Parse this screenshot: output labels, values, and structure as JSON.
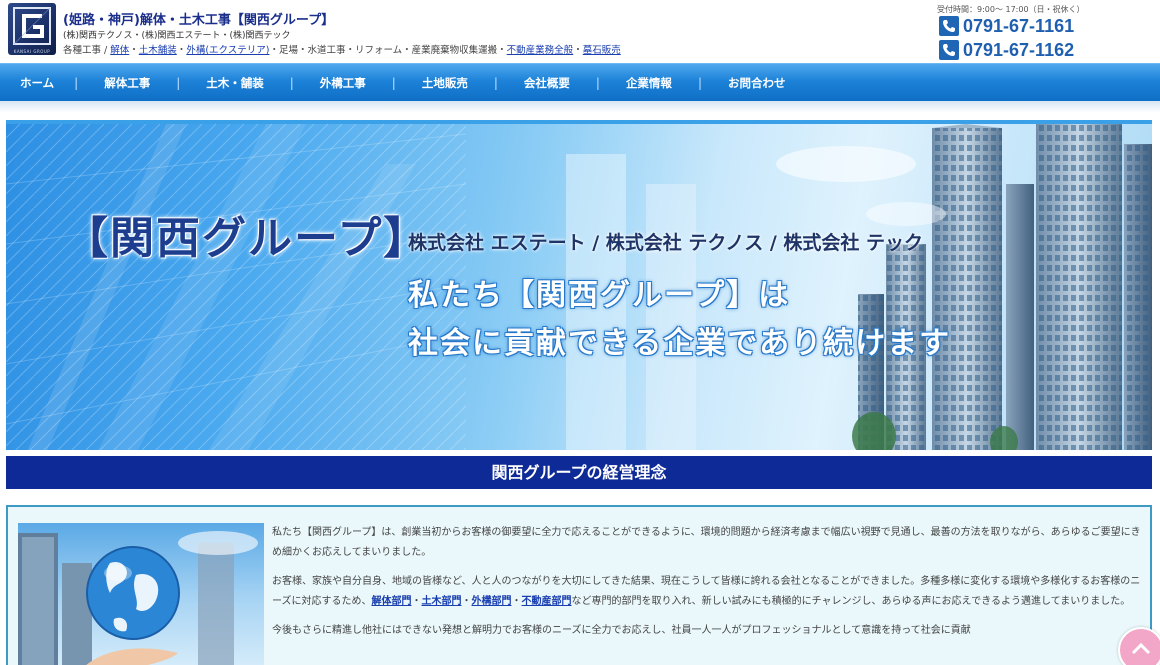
{
  "header": {
    "logo_text": "KANSAI GROUP",
    "title": "(姫路・神戸)解体・土木工事【関西グループ】",
    "companies": "(株)関西テクノス・(株)関西エステート・(株)関西テック",
    "services_prefix": "各種工事 / ",
    "services": [
      {
        "label": "解体",
        "link": true
      },
      {
        "label": "・",
        "link": false
      },
      {
        "label": "土木舗装",
        "link": true
      },
      {
        "label": "・",
        "link": false
      },
      {
        "label": "外構(エクステリア)",
        "link": true
      },
      {
        "label": "・足場・水道工事・リフォーム・産業廃棄物収集運搬・",
        "link": false
      },
      {
        "label": "不動産業務全般",
        "link": true
      },
      {
        "label": "・",
        "link": false
      },
      {
        "label": "墓石販売",
        "link": true
      }
    ],
    "hours": "受付時間：9:00～ 17:00（日・祝休く）",
    "tel1": "0791-67-1161",
    "tel2": "0791-67-1162"
  },
  "nav": {
    "items": [
      "ホーム",
      "解体工事",
      "土木・舗装",
      "外構工事",
      "土地販売",
      "会社概要",
      "企業情報",
      "お問合わせ"
    ]
  },
  "hero": {
    "brand": "【関西グループ】",
    "companies": "株式会社 エステート / 株式会社 テクノス / 株式会社 テック",
    "line1": "私たち【関西グループ】は",
    "line2": "社会に貢献できる企業であり続けます"
  },
  "section": {
    "heading": "関西グループの経営理念"
  },
  "philosophy": {
    "p1": "私たち【関西グループ】は、創業当初からお客様の御要望に全力で応えることができるように、環境的問題から経済考慮まで幅広い視野で見通し、最善の方法を取りながら、あらゆるご要望にきめ細かくお応えしてまいりました。",
    "p2_before": "お客様、家族や自分自身、地域の皆様など、人と人のつながりを大切にしてきた結果、現在こうして皆様に誇れる会社となることができました。多種多様に変化する環境や多様化するお客様のニーズに対応するため、",
    "p2_links": [
      "解体部門",
      "土木部門",
      "外構部門",
      "不動産部門"
    ],
    "p2_after": "など専門的部門を取り入れ、新しい試みにも積極的にチャレンジし、あらゆる声にお応えできるよう邁進してまいりました。",
    "p3": "今後もさらに精進し他社にはできない発想と解明力でお客様のニーズに全力でお応えし、社員一人一人がプロフェッショナルとして意識を持って社会に貢献"
  },
  "colors": {
    "nav_blue": "#1d82d8",
    "heading_navy": "#0d2a96",
    "link_blue": "#1a3fb0"
  }
}
